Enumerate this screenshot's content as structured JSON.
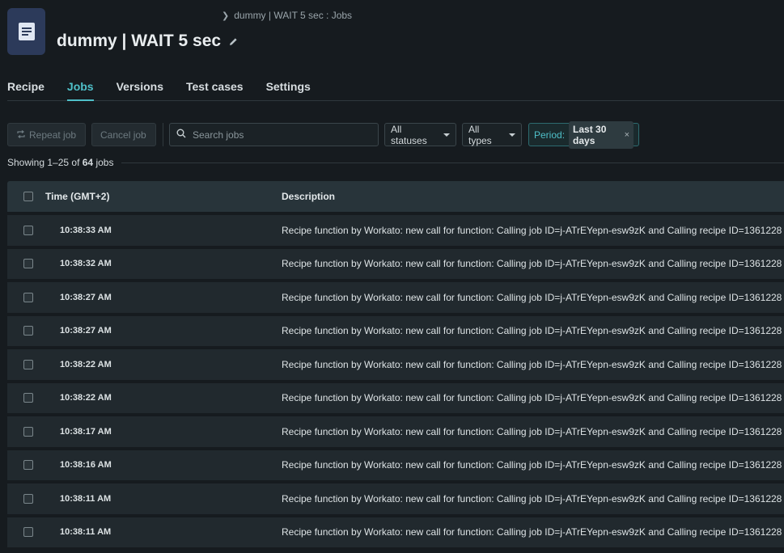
{
  "header": {
    "breadcrumb": "dummy | WAIT 5 sec : Jobs",
    "title": "dummy | WAIT 5 sec"
  },
  "tabs": [
    {
      "label": "Recipe",
      "active": false
    },
    {
      "label": "Jobs",
      "active": true
    },
    {
      "label": "Versions",
      "active": false
    },
    {
      "label": "Test cases",
      "active": false
    },
    {
      "label": "Settings",
      "active": false
    }
  ],
  "toolbar": {
    "repeat_label": "Repeat job",
    "cancel_label": "Cancel job",
    "search_placeholder": "Search jobs",
    "status_filter": "All statuses",
    "type_filter": "All types",
    "period_label": "Period:",
    "period_value": "Last 30 days",
    "period_clear": "×"
  },
  "summary": {
    "prefix": "Showing 1–25 of ",
    "total": "64",
    "suffix": " jobs"
  },
  "table": {
    "headers": {
      "time": "Time (GMT+2)",
      "description": "Description"
    },
    "rows": [
      {
        "time": "10:38:33 AM",
        "description": "Recipe function by Workato: new call for function: Calling job ID=j-ATrEYepn-esw9zK and Calling recipe ID=1361228"
      },
      {
        "time": "10:38:32 AM",
        "description": "Recipe function by Workato: new call for function: Calling job ID=j-ATrEYepn-esw9zK and Calling recipe ID=1361228"
      },
      {
        "time": "10:38:27 AM",
        "description": "Recipe function by Workato: new call for function: Calling job ID=j-ATrEYepn-esw9zK and Calling recipe ID=1361228"
      },
      {
        "time": "10:38:27 AM",
        "description": "Recipe function by Workato: new call for function: Calling job ID=j-ATrEYepn-esw9zK and Calling recipe ID=1361228"
      },
      {
        "time": "10:38:22 AM",
        "description": "Recipe function by Workato: new call for function: Calling job ID=j-ATrEYepn-esw9zK and Calling recipe ID=1361228"
      },
      {
        "time": "10:38:22 AM",
        "description": "Recipe function by Workato: new call for function: Calling job ID=j-ATrEYepn-esw9zK and Calling recipe ID=1361228"
      },
      {
        "time": "10:38:17 AM",
        "description": "Recipe function by Workato: new call for function: Calling job ID=j-ATrEYepn-esw9zK and Calling recipe ID=1361228"
      },
      {
        "time": "10:38:16 AM",
        "description": "Recipe function by Workato: new call for function: Calling job ID=j-ATrEYepn-esw9zK and Calling recipe ID=1361228"
      },
      {
        "time": "10:38:11 AM",
        "description": "Recipe function by Workato: new call for function: Calling job ID=j-ATrEYepn-esw9zK and Calling recipe ID=1361228"
      },
      {
        "time": "10:38:11 AM",
        "description": "Recipe function by Workato: new call for function: Calling job ID=j-ATrEYepn-esw9zK and Calling recipe ID=1361228"
      }
    ]
  },
  "icons": {
    "recipe": "document-icon",
    "breadcrumb": "chevron-right-icon",
    "edit": "pencil-icon",
    "repeat": "repeat-icon",
    "search": "search-icon",
    "dropdown": "caret-down-icon"
  },
  "colors": {
    "accent": "#4fc0c9",
    "background": "#161b1f",
    "row": "#21292e",
    "header_row": "#28343a",
    "recipe_icon_bg": "#2c3a5a"
  }
}
